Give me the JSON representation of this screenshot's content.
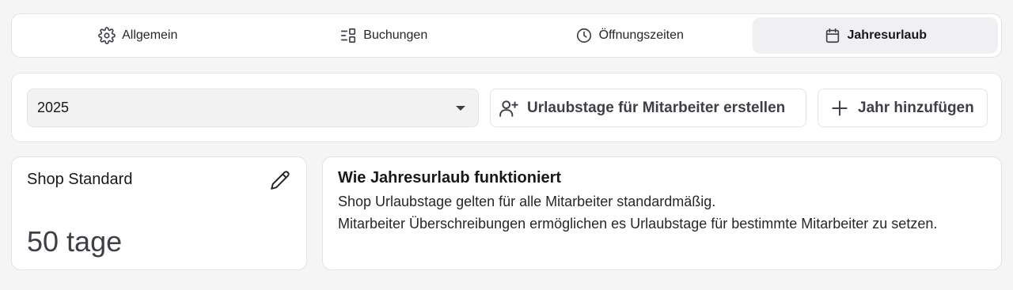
{
  "tabs": [
    {
      "label": "Allgemein",
      "icon": "gear-icon",
      "active": false
    },
    {
      "label": "Buchungen",
      "icon": "layout-icon",
      "active": false
    },
    {
      "label": "Öffnungszeiten",
      "icon": "clock-icon",
      "active": false
    },
    {
      "label": "Jahresurlaub",
      "icon": "calendar-icon",
      "active": true
    }
  ],
  "toolbar": {
    "year_select_value": "2025",
    "create_vacation_label": "Urlaubstage für Mitarbeiter erstellen",
    "add_year_label": "Jahr hinzufügen"
  },
  "shop_card": {
    "title": "Shop Standard",
    "days": "50 tage"
  },
  "info_card": {
    "title": "Wie Jahresurlaub funktioniert",
    "line1": "Shop Urlaubstage gelten für alle Mitarbeiter standardmäßig.",
    "line2": "Mitarbeiter Überschreibungen ermöglichen es Urlaubstage für bestimmte Mitarbeiter zu setzen."
  }
}
